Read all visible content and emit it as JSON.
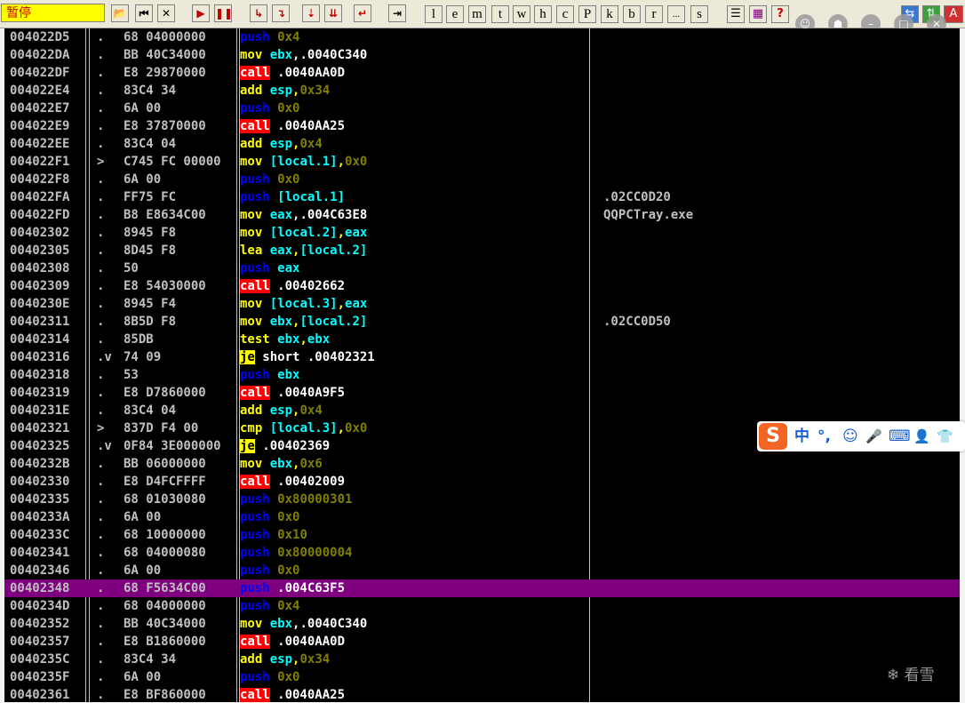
{
  "toolbar": {
    "status": "暂停",
    "letters": [
      "l",
      "e",
      "m",
      "t",
      "w",
      "h",
      "c",
      "P",
      "k",
      "b",
      "r",
      "...",
      "s"
    ],
    "window_controls": [
      "☺",
      "☗",
      "–",
      "□",
      "✕"
    ]
  },
  "disasm": {
    "rows": [
      {
        "addr": "004022D5",
        "mark": ".",
        "hex": "68 04000000",
        "mnem": "push",
        "type": "push",
        "ops": [
          {
            "t": " "
          },
          {
            "t": "0x4",
            "k": "num"
          }
        ],
        "comment": ""
      },
      {
        "addr": "004022DA",
        "mark": ".",
        "hex": "BB 40C34000",
        "mnem": "mov",
        "type": "normal",
        "ops": [
          {
            "t": " "
          },
          {
            "t": "ebx",
            "k": "reg"
          },
          {
            "t": ",.0040C340",
            "k": "addr"
          }
        ],
        "comment": ""
      },
      {
        "addr": "004022DF",
        "mark": ".",
        "hex": "E8 29870000",
        "mnem": "call",
        "type": "call",
        "ops": [
          {
            "t": " .0040AA0D",
            "k": "addr"
          }
        ],
        "comment": ""
      },
      {
        "addr": "004022E4",
        "mark": ".",
        "hex": "83C4 34",
        "mnem": "add",
        "type": "normal",
        "ops": [
          {
            "t": " "
          },
          {
            "t": "esp",
            "k": "reg"
          },
          {
            "t": ","
          },
          {
            "t": "0x34",
            "k": "num"
          }
        ],
        "comment": ""
      },
      {
        "addr": "004022E7",
        "mark": ".",
        "hex": "6A 00",
        "mnem": "push",
        "type": "push",
        "ops": [
          {
            "t": " "
          },
          {
            "t": "0x0",
            "k": "num"
          }
        ],
        "comment": ""
      },
      {
        "addr": "004022E9",
        "mark": ".",
        "hex": "E8 37870000",
        "mnem": "call",
        "type": "call",
        "ops": [
          {
            "t": " .0040AA25",
            "k": "addr"
          }
        ],
        "comment": ""
      },
      {
        "addr": "004022EE",
        "mark": ".",
        "hex": "83C4 04",
        "mnem": "add",
        "type": "normal",
        "ops": [
          {
            "t": " "
          },
          {
            "t": "esp",
            "k": "reg"
          },
          {
            "t": ","
          },
          {
            "t": "0x4",
            "k": "num"
          }
        ],
        "comment": ""
      },
      {
        "addr": "004022F1",
        "mark": ">",
        "hex": "C745 FC 00000",
        "mnem": "mov",
        "type": "normal",
        "ops": [
          {
            "t": " "
          },
          {
            "t": "[local.1]",
            "k": "mem"
          },
          {
            "t": ","
          },
          {
            "t": "0x0",
            "k": "num"
          }
        ],
        "comment": ""
      },
      {
        "addr": "004022F8",
        "mark": ".",
        "hex": "6A 00",
        "mnem": "push",
        "type": "push",
        "ops": [
          {
            "t": " "
          },
          {
            "t": "0x0",
            "k": "num"
          }
        ],
        "comment": ""
      },
      {
        "addr": "004022FA",
        "mark": ".",
        "hex": "FF75 FC",
        "mnem": "push",
        "type": "push",
        "ops": [
          {
            "t": " "
          },
          {
            "t": "[local.1]",
            "k": "mem"
          }
        ],
        "comment": ".02CC0D20"
      },
      {
        "addr": "004022FD",
        "mark": ".",
        "hex": "B8 E8634C00",
        "mnem": "mov",
        "type": "normal",
        "ops": [
          {
            "t": " "
          },
          {
            "t": "eax",
            "k": "reg"
          },
          {
            "t": ",.004C63E8",
            "k": "addr"
          }
        ],
        "comment": "QQPCTray.exe"
      },
      {
        "addr": "00402302",
        "mark": ".",
        "hex": "8945 F8",
        "mnem": "mov",
        "type": "normal",
        "ops": [
          {
            "t": " "
          },
          {
            "t": "[local.2]",
            "k": "mem"
          },
          {
            "t": ","
          },
          {
            "t": "eax",
            "k": "reg"
          }
        ],
        "comment": ""
      },
      {
        "addr": "00402305",
        "mark": ".",
        "hex": "8D45 F8",
        "mnem": "lea",
        "type": "normal",
        "ops": [
          {
            "t": " "
          },
          {
            "t": "eax",
            "k": "reg"
          },
          {
            "t": ","
          },
          {
            "t": "[local.2]",
            "k": "mem"
          }
        ],
        "comment": ""
      },
      {
        "addr": "00402308",
        "mark": ".",
        "hex": "50",
        "mnem": "push",
        "type": "push",
        "ops": [
          {
            "t": " "
          },
          {
            "t": "eax",
            "k": "reg"
          }
        ],
        "comment": ""
      },
      {
        "addr": "00402309",
        "mark": ".",
        "hex": "E8 54030000",
        "mnem": "call",
        "type": "call",
        "ops": [
          {
            "t": " .00402662",
            "k": "addr"
          }
        ],
        "comment": ""
      },
      {
        "addr": "0040230E",
        "mark": ".",
        "hex": "8945 F4",
        "mnem": "mov",
        "type": "normal",
        "ops": [
          {
            "t": " "
          },
          {
            "t": "[local.3]",
            "k": "mem"
          },
          {
            "t": ","
          },
          {
            "t": "eax",
            "k": "reg"
          }
        ],
        "comment": ""
      },
      {
        "addr": "00402311",
        "mark": ".",
        "hex": "8B5D F8",
        "mnem": "mov",
        "type": "normal",
        "ops": [
          {
            "t": " "
          },
          {
            "t": "ebx",
            "k": "reg"
          },
          {
            "t": ","
          },
          {
            "t": "[local.2]",
            "k": "mem"
          }
        ],
        "comment": ".02CC0D50"
      },
      {
        "addr": "00402314",
        "mark": ".",
        "hex": "85DB",
        "mnem": "test",
        "type": "normal",
        "ops": [
          {
            "t": " "
          },
          {
            "t": "ebx",
            "k": "reg"
          },
          {
            "t": ","
          },
          {
            "t": "ebx",
            "k": "reg"
          }
        ],
        "comment": ""
      },
      {
        "addr": "00402316",
        "mark": ".v",
        "hex": "74 09",
        "mnem": "je",
        "type": "jump",
        "ops": [
          {
            "t": " short .00402321",
            "k": "addr"
          }
        ],
        "comment": ""
      },
      {
        "addr": "00402318",
        "mark": ".",
        "hex": "53",
        "mnem": "push",
        "type": "push",
        "ops": [
          {
            "t": " "
          },
          {
            "t": "ebx",
            "k": "reg"
          }
        ],
        "comment": ""
      },
      {
        "addr": "00402319",
        "mark": ".",
        "hex": "E8 D7860000",
        "mnem": "call",
        "type": "call",
        "ops": [
          {
            "t": " .0040A9F5",
            "k": "addr"
          }
        ],
        "comment": ""
      },
      {
        "addr": "0040231E",
        "mark": ".",
        "hex": "83C4 04",
        "mnem": "add",
        "type": "normal",
        "ops": [
          {
            "t": " "
          },
          {
            "t": "esp",
            "k": "reg"
          },
          {
            "t": ","
          },
          {
            "t": "0x4",
            "k": "num"
          }
        ],
        "comment": ""
      },
      {
        "addr": "00402321",
        "mark": ">",
        "hex": "837D F4 00",
        "mnem": "cmp",
        "type": "normal",
        "ops": [
          {
            "t": " "
          },
          {
            "t": "[local.3]",
            "k": "mem"
          },
          {
            "t": ","
          },
          {
            "t": "0x0",
            "k": "num"
          }
        ],
        "comment": ""
      },
      {
        "addr": "00402325",
        "mark": ".v",
        "hex": "0F84 3E000000",
        "mnem": "je",
        "type": "jump",
        "ops": [
          {
            "t": " .00402369",
            "k": "addr"
          }
        ],
        "comment": ""
      },
      {
        "addr": "0040232B",
        "mark": ".",
        "hex": "BB 06000000",
        "mnem": "mov",
        "type": "normal",
        "ops": [
          {
            "t": " "
          },
          {
            "t": "ebx",
            "k": "reg"
          },
          {
            "t": ","
          },
          {
            "t": "0x6",
            "k": "num"
          }
        ],
        "comment": ""
      },
      {
        "addr": "00402330",
        "mark": ".",
        "hex": "E8 D4FCFFFF",
        "mnem": "call",
        "type": "call",
        "ops": [
          {
            "t": " .00402009",
            "k": "addr"
          }
        ],
        "comment": ""
      },
      {
        "addr": "00402335",
        "mark": ".",
        "hex": "68 01030080",
        "mnem": "push",
        "type": "push",
        "ops": [
          {
            "t": " "
          },
          {
            "t": "0x80000301",
            "k": "num"
          }
        ],
        "comment": ""
      },
      {
        "addr": "0040233A",
        "mark": ".",
        "hex": "6A 00",
        "mnem": "push",
        "type": "push",
        "ops": [
          {
            "t": " "
          },
          {
            "t": "0x0",
            "k": "num"
          }
        ],
        "comment": ""
      },
      {
        "addr": "0040233C",
        "mark": ".",
        "hex": "68 10000000",
        "mnem": "push",
        "type": "push",
        "ops": [
          {
            "t": " "
          },
          {
            "t": "0x10",
            "k": "num"
          }
        ],
        "comment": ""
      },
      {
        "addr": "00402341",
        "mark": ".",
        "hex": "68 04000080",
        "mnem": "push",
        "type": "push",
        "ops": [
          {
            "t": " "
          },
          {
            "t": "0x80000004",
            "k": "num"
          }
        ],
        "comment": ""
      },
      {
        "addr": "00402346",
        "mark": ".",
        "hex": "6A 00",
        "mnem": "push",
        "type": "push",
        "ops": [
          {
            "t": " "
          },
          {
            "t": "0x0",
            "k": "num"
          }
        ],
        "comment": ""
      },
      {
        "addr": "00402348",
        "mark": ".",
        "hex": "68 F5634C00",
        "mnem": "push",
        "type": "push",
        "ops": [
          {
            "t": " .004C63F5",
            "k": "addr"
          }
        ],
        "comment": "",
        "selected": true
      },
      {
        "addr": "0040234D",
        "mark": ".",
        "hex": "68 04000000",
        "mnem": "push",
        "type": "push",
        "ops": [
          {
            "t": " "
          },
          {
            "t": "0x4",
            "k": "num"
          }
        ],
        "comment": ""
      },
      {
        "addr": "00402352",
        "mark": ".",
        "hex": "BB 40C34000",
        "mnem": "mov",
        "type": "normal",
        "ops": [
          {
            "t": " "
          },
          {
            "t": "ebx",
            "k": "reg"
          },
          {
            "t": ",.0040C340",
            "k": "addr"
          }
        ],
        "comment": ""
      },
      {
        "addr": "00402357",
        "mark": ".",
        "hex": "E8 B1860000",
        "mnem": "call",
        "type": "call",
        "ops": [
          {
            "t": " .0040AA0D",
            "k": "addr"
          }
        ],
        "comment": ""
      },
      {
        "addr": "0040235C",
        "mark": ".",
        "hex": "83C4 34",
        "mnem": "add",
        "type": "normal",
        "ops": [
          {
            "t": " "
          },
          {
            "t": "esp",
            "k": "reg"
          },
          {
            "t": ","
          },
          {
            "t": "0x34",
            "k": "num"
          }
        ],
        "comment": ""
      },
      {
        "addr": "0040235F",
        "mark": ".",
        "hex": "6A 00",
        "mnem": "push",
        "type": "push",
        "ops": [
          {
            "t": " "
          },
          {
            "t": "0x0",
            "k": "num"
          }
        ],
        "comment": ""
      },
      {
        "addr": "00402361",
        "mark": ".",
        "hex": "E8 BF860000",
        "mnem": "call",
        "type": "call",
        "ops": [
          {
            "t": " .0040AA25",
            "k": "addr"
          }
        ],
        "comment": ""
      }
    ]
  },
  "ime": {
    "logo": "S",
    "items": [
      "中",
      "°,",
      "☺",
      "🎤",
      "⌨",
      "👤",
      "👕"
    ]
  },
  "watermark": "看雪",
  "colors": {
    "push": "#0000ff",
    "normal": "#ffff00",
    "call_bg": "#ff0000",
    "jump_bg": "#ffff00",
    "selected_row": "#7f007f",
    "register": "#00ffff",
    "immediate": "#808000"
  }
}
